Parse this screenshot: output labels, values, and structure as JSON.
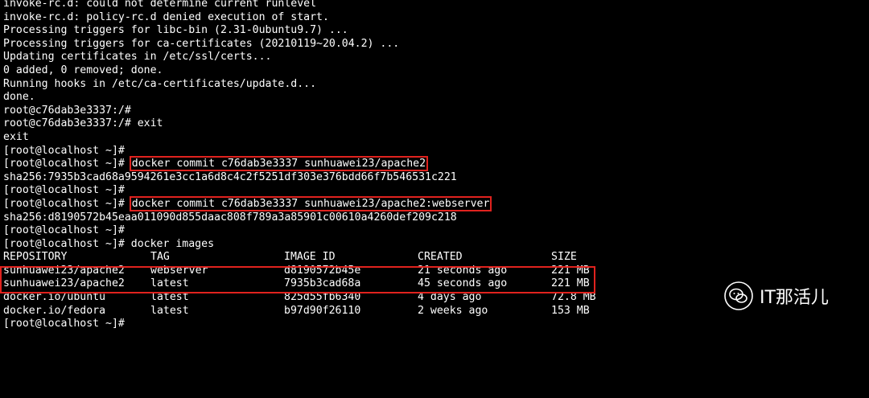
{
  "terminal": {
    "lines": [
      "invoke-rc.d: could not determine current runlevel",
      "invoke-rc.d: policy-rc.d denied execution of start.",
      "Processing triggers for libc-bin (2.31-0ubuntu9.7) ...",
      "Processing triggers for ca-certificates (20210119~20.04.2) ...",
      "Updating certificates in /etc/ssl/certs...",
      "0 added, 0 removed; done.",
      "Running hooks in /etc/ca-certificates/update.d...",
      "done.",
      "root@c76dab3e3337:/#",
      "root@c76dab3e3337:/# exit",
      "exit",
      "[root@localhost ~]#"
    ],
    "prompt": "[root@localhost ~]# ",
    "cmd1": "docker commit c76dab3e3337 sunhuawei23/apache2",
    "out1": "sha256:7935b3cad68a9594261e3cc1a6d8c4c2f5251df303e376bdd66f7b546531c221",
    "line_after1": "[root@localhost ~]#",
    "cmd2": "docker commit c76dab3e3337 sunhuawei23/apache2:webserver",
    "out2": "sha256:d8190572b45eaa011090d855daac808f789a3a85901c00610a4260def209c218",
    "line_after2": "[root@localhost ~]#",
    "images_cmd_line": "[root@localhost ~]# docker images",
    "table": {
      "headers": [
        "REPOSITORY",
        "TAG",
        "IMAGE ID",
        "CREATED",
        "SIZE"
      ],
      "rows": [
        [
          "sunhuawei23/apache2",
          "webserver",
          "d8190572b45e",
          "21 seconds ago",
          "221 MB"
        ],
        [
          "sunhuawei23/apache2",
          "latest",
          "7935b3cad68a",
          "45 seconds ago",
          "221 MB"
        ],
        [
          "docker.io/ubuntu",
          "latest",
          "825d55fb6340",
          "4 days ago",
          "72.8 MB"
        ],
        [
          "docker.io/fedora",
          "latest",
          "b97d90f26110",
          "2 weeks ago",
          "153 MB"
        ]
      ]
    },
    "last_prompt": "[root@localhost ~]#"
  },
  "watermark": {
    "text": "IT那活儿",
    "icon": "wechat-icon"
  },
  "colors": {
    "highlight": "#e0221e",
    "background": "#000000",
    "text": "#ffffff"
  }
}
